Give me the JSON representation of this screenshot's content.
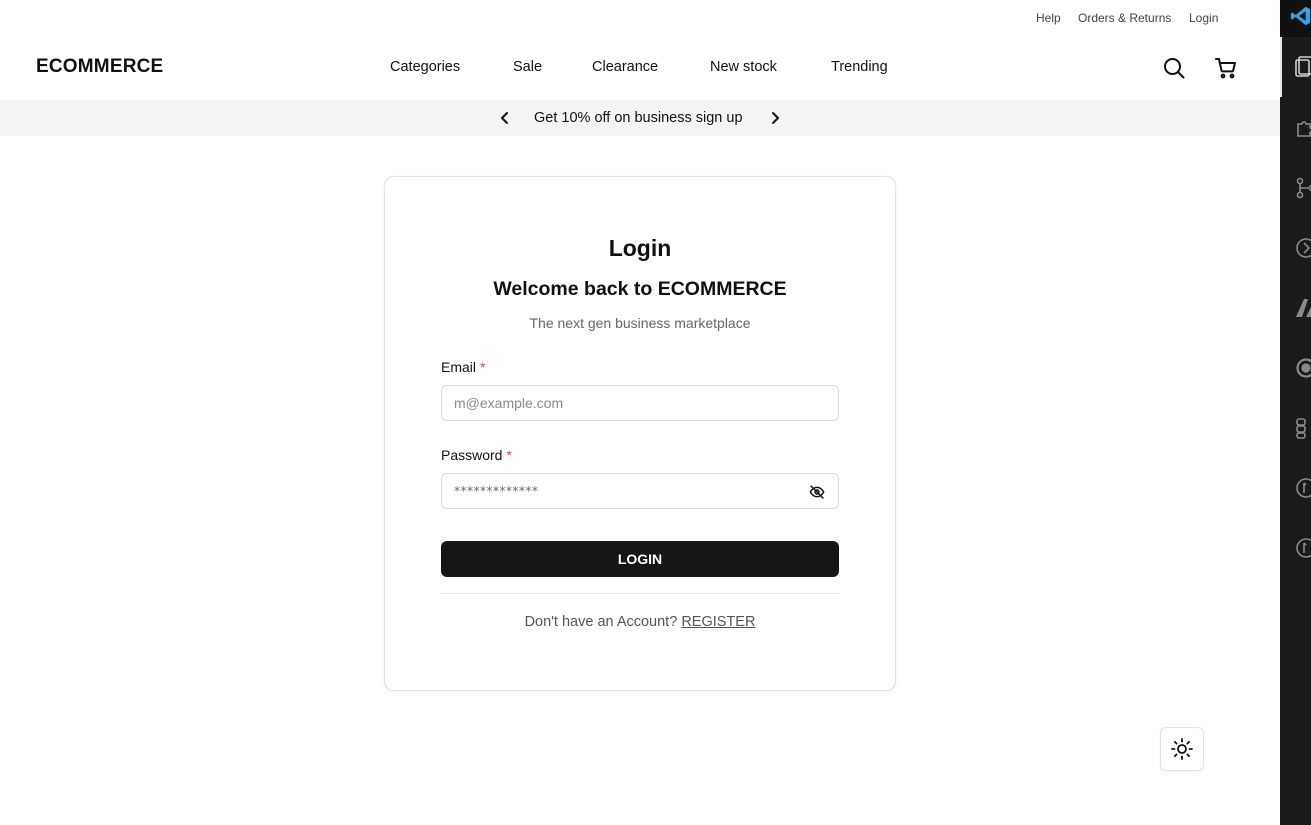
{
  "utility_links": {
    "help": "Help",
    "orders": "Orders & Returns",
    "login": "Login"
  },
  "header": {
    "logo": "ECOMMERCE",
    "nav": [
      "Categories",
      "Sale",
      "Clearance",
      "New stock",
      "Trending"
    ],
    "icons": [
      "search-icon",
      "cart-icon"
    ]
  },
  "promo": {
    "text": "Get 10% off on business sign up"
  },
  "login_card": {
    "title": "Login",
    "subtitle": "Welcome back to ECOMMERCE",
    "description": "The next gen business marketplace",
    "email_label": "Email",
    "email_placeholder": "m@example.com",
    "password_label": "Password",
    "password_value": "*************",
    "required_marker": "*",
    "submit_label": "LOGIN",
    "register_prompt": "Don't have an Account?",
    "register_link": "REGISTER"
  },
  "colors": {
    "accent_button": "#161616",
    "required": "#e0444e",
    "promo_bg": "#f4f4f4",
    "editor_bar": "#1a1a1a",
    "editor_logo": "#3aa0e6"
  }
}
